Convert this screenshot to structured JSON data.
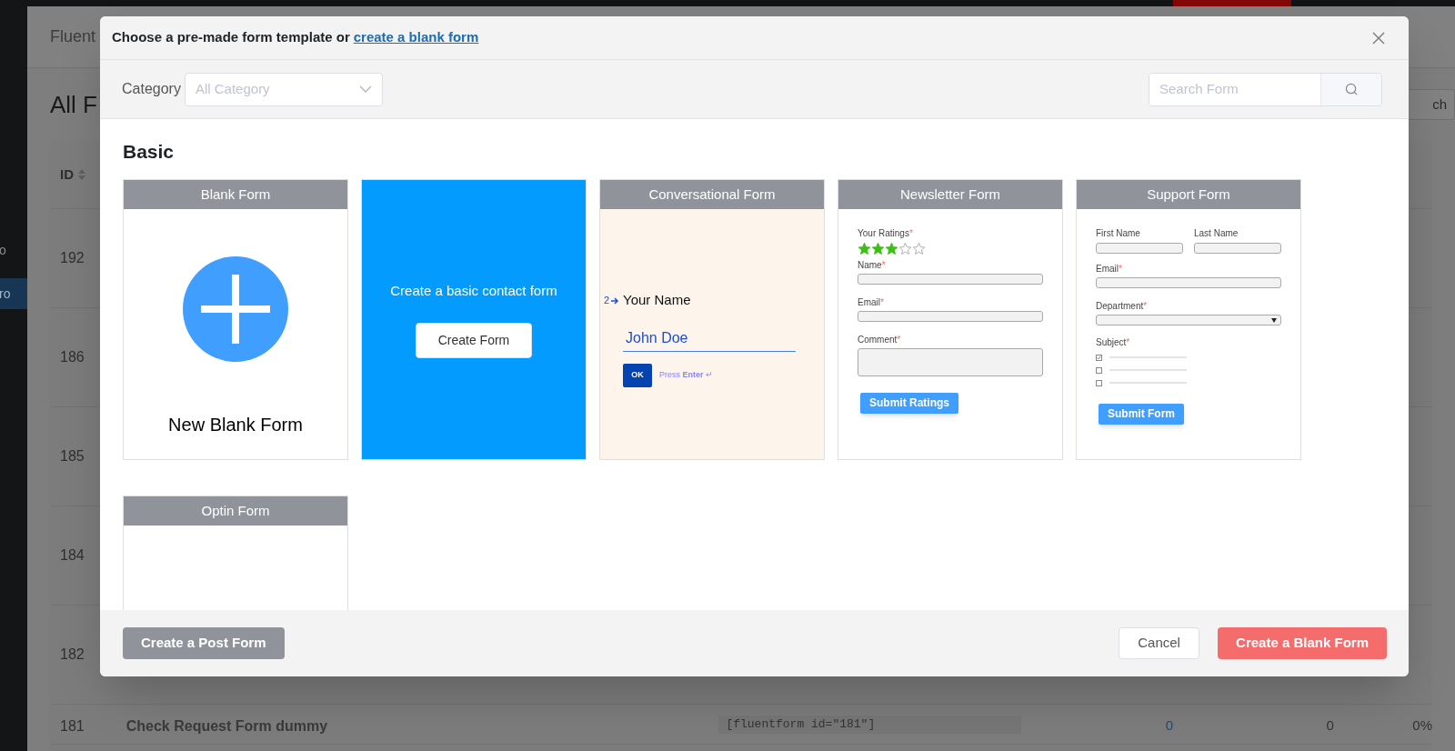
{
  "background": {
    "sidebar_items": [
      {
        "label": "o",
        "selected": false
      },
      {
        "label": "ro",
        "selected": true
      }
    ],
    "page_title": "Fluent",
    "heading": "All F",
    "header_button": "ch",
    "table": {
      "columns": [
        {
          "label": "ID"
        }
      ],
      "rows": [
        {
          "id": "192"
        },
        {
          "id": "186"
        },
        {
          "id": "185"
        },
        {
          "id": "184"
        },
        {
          "id": "182"
        },
        {
          "id": "181",
          "title": "Check Request Form dummy",
          "shortcode": "[fluentform id=\"181\"]",
          "column_3": "0",
          "column_4": "0",
          "column_5": "0%"
        }
      ]
    }
  },
  "modal": {
    "title": "Choose a pre-made form template or",
    "title_link": "create a blank form",
    "category_label": "Category",
    "category_select": {
      "placeholder": "All Category"
    },
    "search": {
      "placeholder": "Search Form"
    },
    "section": "Basic",
    "templates": [
      {
        "kind": "blank",
        "title": "Blank Form",
        "label": "New Blank Form"
      },
      {
        "kind": "cta",
        "text": "Create a basic contact form",
        "button": "Create Form"
      },
      {
        "kind": "conversational",
        "title": "Conversational Form",
        "number": "2",
        "question": "Your Name",
        "answer": "John Doe",
        "button": "OK",
        "hint": "Press **Enter** ↵"
      },
      {
        "kind": "form",
        "title": "Newsletter Form",
        "fields": [
          {
            "kind": "stars",
            "label": "Your Ratings",
            "mark": "*",
            "stars": 3
          },
          {
            "kind": "text",
            "label": "Name",
            "mark": "*"
          },
          {
            "kind": "text",
            "label": "Email",
            "mark": "*"
          },
          {
            "kind": "textarea",
            "label": "Comment",
            "mark": "*"
          }
        ],
        "button": "Submit Ratings"
      },
      {
        "kind": "form",
        "title": "Support Form",
        "fields": [
          {
            "kind": "pair",
            "labels": [
              "First Name",
              "Last Name"
            ]
          },
          {
            "kind": "text",
            "label": "Email",
            "mark": "*"
          },
          {
            "kind": "select",
            "label": "Department",
            "mark": "*"
          },
          {
            "kind": "checkboxes",
            "label": "Subject",
            "mark": "*",
            "options": [
              {
                "checked": true
              },
              {
                "checked": false
              },
              {
                "checked": false
              }
            ]
          }
        ],
        "button": "Submit Form"
      },
      {
        "kind": "blank_preview",
        "title": "Optin Form"
      }
    ],
    "footer": {
      "post_button": "Create a Post Form",
      "cancel_button": "Cancel",
      "create_button": "Create a Blank Form"
    }
  }
}
